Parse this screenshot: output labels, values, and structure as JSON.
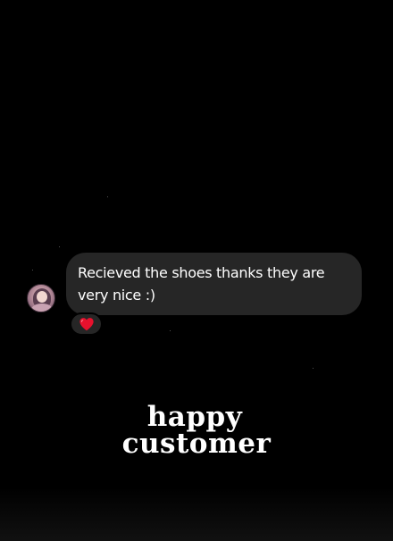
{
  "message": {
    "text": "Recieved the shoes thanks they are very nice :)",
    "reaction": "heart-icon"
  },
  "caption": {
    "line1": "happy",
    "line2": "customer"
  },
  "colors": {
    "background": "#000000",
    "bubble": "#262626",
    "text": "#ffffff",
    "heart": "#e8112d"
  }
}
